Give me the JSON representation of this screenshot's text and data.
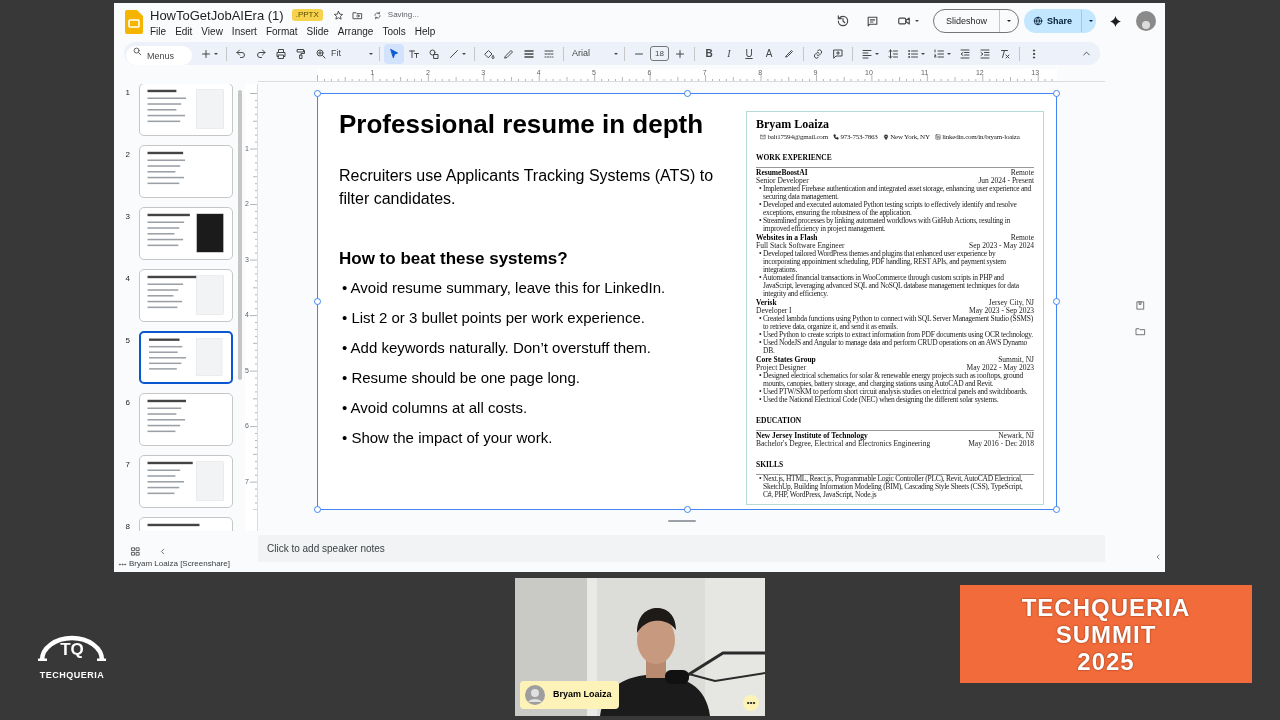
{
  "app": {
    "title": "HowToGetJobAIEra (1)",
    "badge": ".PPTX",
    "save_status": "Saving...",
    "menus": [
      "File",
      "Edit",
      "View",
      "Insert",
      "Format",
      "Slide",
      "Arrange",
      "Tools",
      "Help"
    ],
    "slideshow_button": "Slideshow",
    "share_button": "Share"
  },
  "toolbar": {
    "search": {
      "placeholder": "Menus"
    },
    "zoom": "Fit",
    "tools": [
      {
        "kind": "select",
        "selected": true
      },
      {
        "kind": "textbox",
        "selected": false
      },
      {
        "kind": "shape",
        "selected": false
      },
      {
        "kind": "line",
        "selected": false
      }
    ],
    "font": "Arial",
    "font_size": "18",
    "format_buttons": [
      {
        "kind": "bold",
        "label": "B"
      },
      {
        "kind": "italic",
        "label": "I"
      },
      {
        "kind": "underline",
        "label": "U"
      },
      {
        "kind": "color",
        "label": "A"
      }
    ]
  },
  "rulers": {
    "horizontal": [
      "1",
      "2",
      "3",
      "4",
      "5",
      "6",
      "7",
      "8",
      "9",
      "10",
      "11",
      "12",
      "13"
    ],
    "vertical": [
      "1",
      "2",
      "3",
      "4",
      "5",
      "6",
      "7"
    ]
  },
  "thumbnails": [
    {
      "number": "1",
      "selected": false
    },
    {
      "number": "2",
      "selected": false
    },
    {
      "number": "3",
      "selected": false
    },
    {
      "number": "4",
      "selected": false
    },
    {
      "number": "5",
      "selected": true
    },
    {
      "number": "6",
      "selected": false
    },
    {
      "number": "7",
      "selected": false
    },
    {
      "number": "8",
      "selected": false
    }
  ],
  "slide": {
    "title": "Professional resume in depth",
    "intro": "Recruiters use Applicants Tracking Systems (ATS) to filter candidates.",
    "subheading": "How to beat these systems?",
    "bullets": [
      "• Avoid resume summary, leave this for LinkedIn.",
      "• List 2 or 3 bullet points per work experience.",
      "• Add keywords naturally. Don’t overstuff them.",
      "• Resume should be one page long.",
      "• Avoid columns at all costs.",
      "• Show the impact of your work."
    ],
    "resume": {
      "name": "Bryam Loaiza",
      "contacts": [
        {
          "kind": "email",
          "text": "balt17594@gmail.com"
        },
        {
          "kind": "phone",
          "text": "973-753-7863"
        },
        {
          "kind": "location",
          "text": "New York, NY"
        },
        {
          "kind": "linkedin",
          "text": "linkedin.com/in/bryam-loaiza"
        }
      ],
      "sections": [
        {
          "heading": "WORK EXPERIENCE",
          "entries": [
            {
              "org": "ResumeBoostAI",
              "location": "Remote",
              "role": "Senior Developer",
              "dates": "Jun 2024 - Present",
              "bullets": [
                "• Implemented Firebase authentication and integrated asset storage, enhancing user experience and securing data management.",
                "• Developed and executed automated Python testing scripts to effectively identify and resolve exceptions, ensuring the robustness of the application.",
                "• Streamlined processes by linking automated workflows with GitHub Actions, resulting in improved efficiency in project management."
              ]
            },
            {
              "org": "Websites in a Flash",
              "location": "Remote",
              "role": "Full Stack Software Engineer",
              "dates": "Sep 2023 - May 2024",
              "bullets": [
                "• Developed tailored WordPress themes and plugins that enhanced user experience by incorporating appointment scheduling, PDF handling, REST APIs, and payment system integrations.",
                "• Automated financial transactions in WooCommerce through custom scripts in PHP and JavaScript, leveraging advanced SQL and NoSQL database management techniques for data integrity and efficiency."
              ]
            },
            {
              "org": "Verisk",
              "location": "Jersey City, NJ",
              "role": "Developer I",
              "dates": "May 2023 - Sep 2023",
              "bullets": [
                "• Created lambda functions using Python to connect with SQL Server Management Studio (SSMS) to retrieve data, organize it, and send it as emails.",
                "• Used Python to create scripts to extract information from PDF documents using OCR technology.",
                "• Used NodeJS and Angular to manage data and perform CRUD operations on an AWS Dynamo DB."
              ]
            },
            {
              "org": "Core States Group",
              "location": "Summit, NJ",
              "role": "Project Designer",
              "dates": "May 2022 - May 2023",
              "bullets": [
                "• Designed electrical schematics for solar & renewable energy projects such as rooftops, ground mounts, canopies, battery storage, and charging stations using AutoCAD and Revit.",
                "• Used PTW/SKM to perform short circuit analysis studies on electrical panels and switchboards.",
                "• Used the National Electrical Code (NEC) when designing the different solar systems."
              ]
            }
          ]
        },
        {
          "heading": "EDUCATION",
          "entries": [
            {
              "org": "New Jersey Institute of Technology",
              "location": "Newark, NJ",
              "role": "Bachelor's Degree, Electrical and Electronics Engineering",
              "dates": "May 2016 - Dec 2018"
            }
          ]
        },
        {
          "heading": "SKILLS",
          "bullets": [
            "• Next.js, HTML, React.js, Programmable Logic Controller (PLC), Revit, AutoCAD Electrical, SketchUp, Building Information Modeling (BIM), Cascading Style Sheets (CSS), TypeScript, C#, PHP, WordPress, JavaScript, Node.js"
          ]
        }
      ]
    }
  },
  "speaker_notes": {
    "placeholder": "Click to add speaker notes"
  },
  "screenshare_label": "Bryam Loaiza [Screenshare]",
  "video": {
    "name": "Bryam Loaiza"
  },
  "logo": {
    "mark": "TQ",
    "name": "TECHQUERIA"
  },
  "banner": {
    "lines": [
      "TECHQUERIA",
      "SUMMIT",
      "2025"
    ]
  }
}
